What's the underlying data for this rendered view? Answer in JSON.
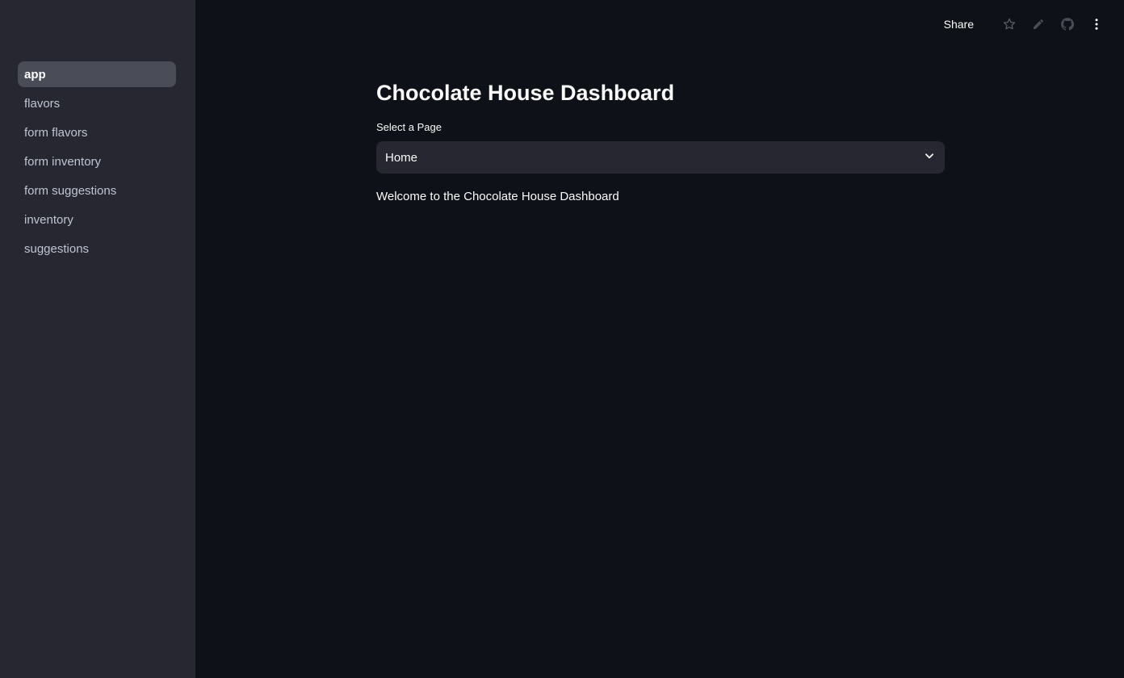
{
  "sidebar": {
    "items": [
      {
        "label": "app",
        "active": true
      },
      {
        "label": "flavors"
      },
      {
        "label": "form flavors"
      },
      {
        "label": "form inventory"
      },
      {
        "label": "form suggestions"
      },
      {
        "label": "inventory"
      },
      {
        "label": "suggestions"
      }
    ]
  },
  "header": {
    "share_label": "Share",
    "icons": [
      "star-icon",
      "edit-icon",
      "github-icon",
      "more-vertical-icon"
    ]
  },
  "main": {
    "title": "Chocolate House Dashboard",
    "select": {
      "label": "Select a Page",
      "value": "Home"
    },
    "welcome_text": "Welcome to the Chocolate House Dashboard"
  },
  "colors": {
    "background": "#0e1117",
    "sidebar": "#262730",
    "active_item": "#4a4c57",
    "text": "#fafafa"
  }
}
